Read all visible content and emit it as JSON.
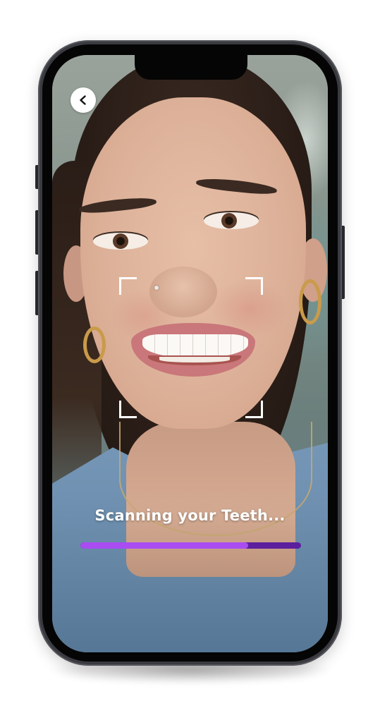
{
  "status": {
    "text": "Scanning your Teeth..."
  },
  "progress": {
    "value": 0.76
  },
  "back_button": {
    "icon": "chevron-left-icon"
  },
  "scan_frame": {
    "icon": "scan-frame-corners"
  },
  "colors": {
    "progress_fill": "#a94cf2",
    "progress_track": "#5c1f9e",
    "overlay_text": "#ffffff",
    "back_button_bg": "#ffffff",
    "phone_body": "#3a3b40"
  }
}
